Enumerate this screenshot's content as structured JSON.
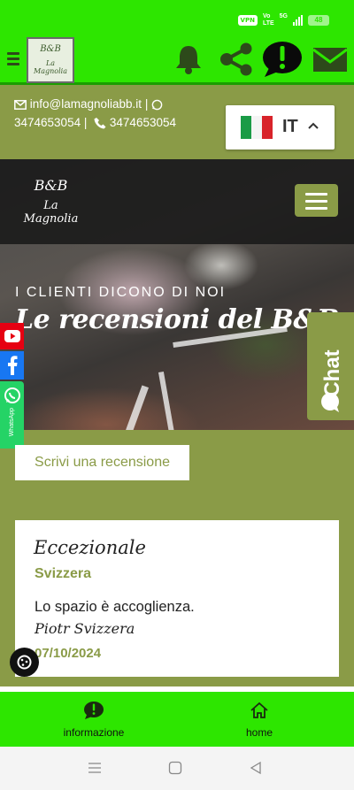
{
  "status_bar": {
    "vpn": "VPN",
    "volte_top": "Vo",
    "volte_bottom": "LTE",
    "network": "5G",
    "battery": "48"
  },
  "header": {
    "logo_line1": "B&B",
    "logo_line2": "La Magnolia"
  },
  "contact": {
    "email": "info@lamagnoliabb.it",
    "sep": "|",
    "whatsapp": "3474653054",
    "phone": "3474653054"
  },
  "language": {
    "code": "IT"
  },
  "hero": {
    "logo_line1": "B&B",
    "logo_line2": "La Magnolia",
    "kicker": "I CLIENTI DICONO DI NOI",
    "title": "Le recensioni del B&B"
  },
  "social": {
    "whatsapp_label": "WhatsApp"
  },
  "chat": {
    "label": "Chat"
  },
  "write_review": {
    "label": "Scrivi una recensione"
  },
  "review": {
    "title": "Eccezionale",
    "country": "Svizzera",
    "text": "Lo spazio è accoglienza.",
    "author": "Piotr Svizzera",
    "date": "07/10/2024"
  },
  "bottom_nav": {
    "items": [
      {
        "label": "informazione"
      },
      {
        "label": "home"
      }
    ]
  },
  "colors": {
    "accent_green": "#2de600",
    "brand_olive": "#8a9b47"
  }
}
